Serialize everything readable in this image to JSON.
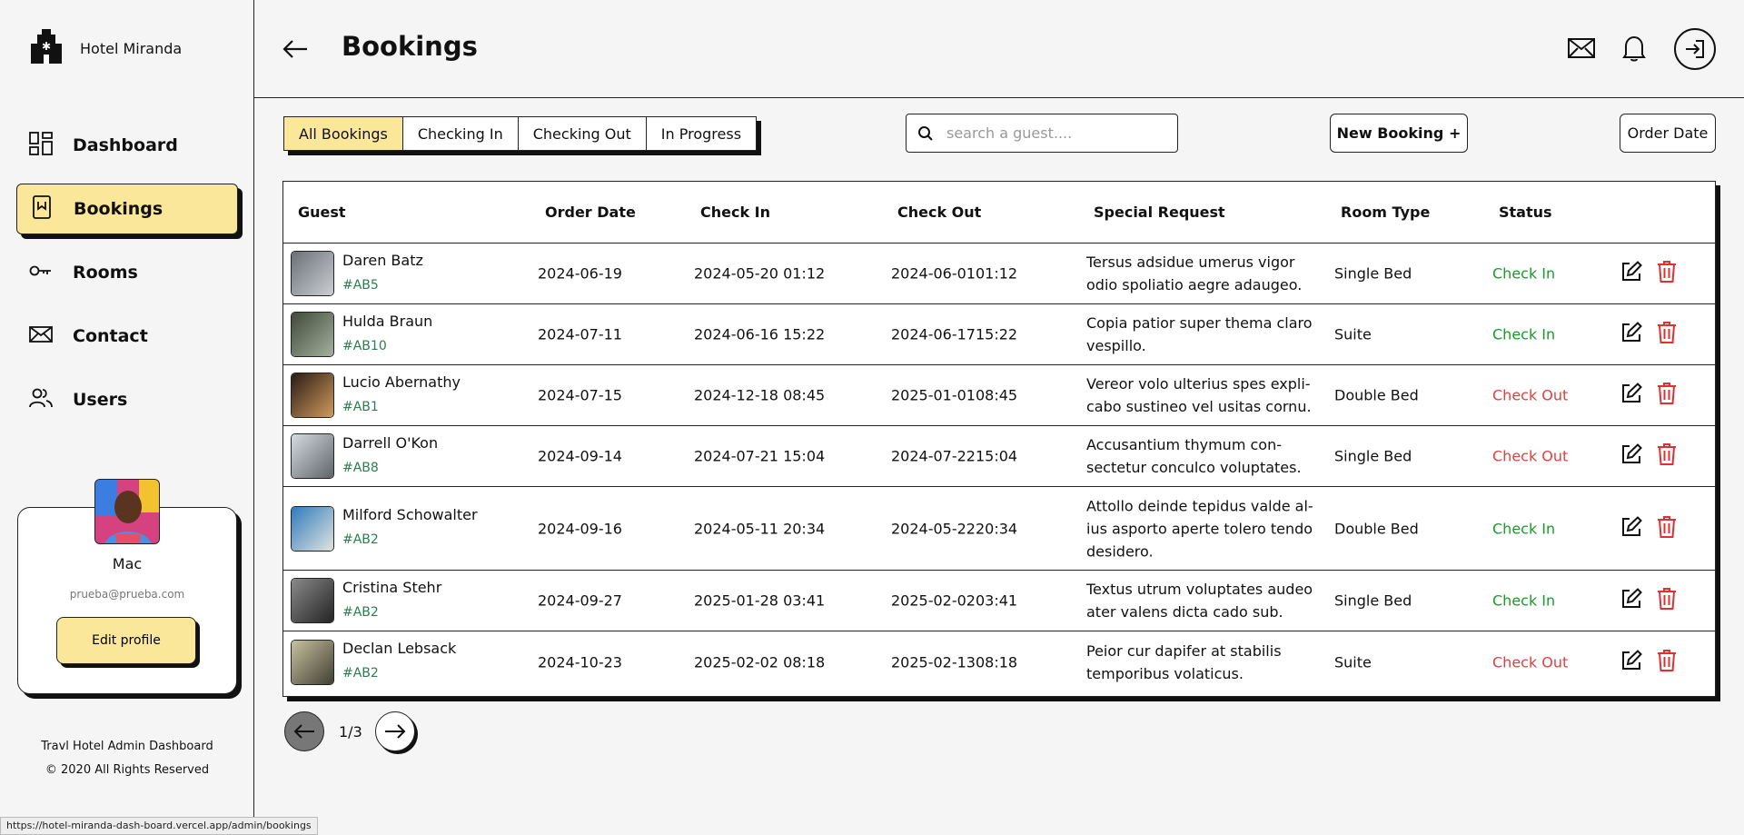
{
  "brand": {
    "name": "Hotel Miranda"
  },
  "nav": [
    {
      "label": "Dashboard",
      "icon": "dashboard-icon",
      "active": false
    },
    {
      "label": "Bookings",
      "icon": "bookmark-icon",
      "active": true
    },
    {
      "label": "Rooms",
      "icon": "key-icon",
      "active": false
    },
    {
      "label": "Contact",
      "icon": "envelope-icon",
      "active": false
    },
    {
      "label": "Users",
      "icon": "users-icon",
      "active": false
    }
  ],
  "profile": {
    "name": "Mac",
    "email": "prueba@prueba.com",
    "edit_label": "Edit profile"
  },
  "footer": {
    "line1": "Travl Hotel Admin Dashboard",
    "line2": "© 2020 All Rights Reserved"
  },
  "header": {
    "title": "Bookings"
  },
  "tabs": [
    {
      "label": "All Bookings",
      "active": true
    },
    {
      "label": "Checking In",
      "active": false
    },
    {
      "label": "Checking Out",
      "active": false
    },
    {
      "label": "In Progress",
      "active": false
    }
  ],
  "search": {
    "placeholder": "search a guest...."
  },
  "new_booking_label": "New Booking +",
  "order_label": "Order Date",
  "columns": [
    "Guest",
    "Order Date",
    "Check In",
    "Check Out",
    "Special Request",
    "Room Type",
    "Status"
  ],
  "rows": [
    {
      "name": "Daren Batz",
      "id": "#AB5",
      "order_date": "2024-06-19",
      "check_in": "2024-05-20 01:12",
      "check_out": "2024-06-0101:12",
      "request": "Tersus adsidue umerus vigor odio spoliatio aegre adaugeo.",
      "room": "Single Bed",
      "status": "Check In"
    },
    {
      "name": "Hulda Braun",
      "id": "#AB10",
      "order_date": "2024-07-11",
      "check_in": "2024-06-16 15:22",
      "check_out": "2024-06-1715:22",
      "request": "Copia patior super thema claro vespillo.",
      "room": "Suite",
      "status": "Check In"
    },
    {
      "name": "Lucio Abernathy",
      "id": "#AB1",
      "order_date": "2024-07-15",
      "check_in": "2024-12-18 08:45",
      "check_out": "2025-01-0108:45",
      "request": "Vereor volo ulterius spes expli-cabo sustineo vel usitas cornu.",
      "room": "Double Bed",
      "status": "Check Out"
    },
    {
      "name": "Darrell O'Kon",
      "id": "#AB8",
      "order_date": "2024-09-14",
      "check_in": "2024-07-21 15:04",
      "check_out": "2024-07-2215:04",
      "request": "Accusantium thymum con-sectetur conculco voluptates.",
      "room": "Single Bed",
      "status": "Check Out"
    },
    {
      "name": "Milford Schowalter",
      "id": "#AB2",
      "order_date": "2024-09-16",
      "check_in": "2024-05-11 20:34",
      "check_out": "2024-05-2220:34",
      "request": "Attollo deinde tepidus valde al-ius asporto aperte tolero tendo desidero.",
      "room": "Double Bed",
      "status": "Check In"
    },
    {
      "name": "Cristina Stehr",
      "id": "#AB2",
      "order_date": "2024-09-27",
      "check_in": "2025-01-28 03:41",
      "check_out": "2025-02-0203:41",
      "request": "Textus utrum voluptates audeo ater valens dicta cado sub.",
      "room": "Single Bed",
      "status": "Check In"
    },
    {
      "name": "Declan Lebsack",
      "id": "#AB2",
      "order_date": "2024-10-23",
      "check_in": "2025-02-02 08:18",
      "check_out": "2025-02-1308:18",
      "request": "Peior cur dapifer at stabilis temporibus volaticus.",
      "room": "Suite",
      "status": "Check Out"
    }
  ],
  "pagination": {
    "text": "1/3"
  },
  "status_url": "https://hotel-miranda-dash-board.vercel.app/admin/bookings",
  "colors": {
    "accent": "#fbe79a",
    "check_in": "#1a9a2a",
    "check_out": "#e04040",
    "guest_id": "#2e7d4f"
  }
}
